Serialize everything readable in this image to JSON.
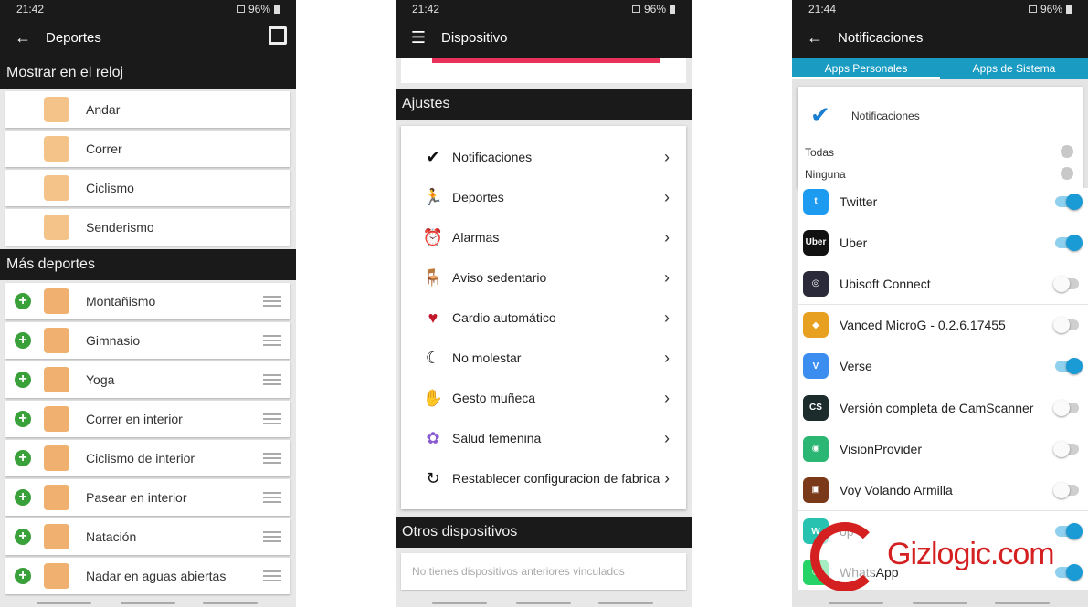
{
  "colors": {
    "dark": "#1a1a1a",
    "accent": "#1a9bc2",
    "plus_green": "#3aa03a",
    "toggle_on": "#1a9bd6"
  },
  "left": {
    "status": {
      "time": "21:42",
      "battery": "96%"
    },
    "title": "Deportes",
    "section_show": "Mostrar en el reloj",
    "shown_sports": [
      {
        "label": "Andar",
        "icon": "walking-icon"
      },
      {
        "label": "Correr",
        "icon": "running-icon"
      },
      {
        "label": "Ciclismo",
        "icon": "cycling-icon"
      },
      {
        "label": "Senderismo",
        "icon": "hiking-icon"
      }
    ],
    "section_more": "Más deportes",
    "more_sports": [
      {
        "label": "Montañismo",
        "icon": "mountain-icon"
      },
      {
        "label": "Gimnasio",
        "icon": "gym-icon"
      },
      {
        "label": "Yoga",
        "icon": "yoga-icon"
      },
      {
        "label": "Correr en interior",
        "icon": "treadmill-run-icon"
      },
      {
        "label": "Ciclismo de interior",
        "icon": "indoor-bike-icon"
      },
      {
        "label": "Pasear en interior",
        "icon": "treadmill-walk-icon"
      },
      {
        "label": "Natación",
        "icon": "swimming-icon"
      },
      {
        "label": "Nadar en aguas abiertas",
        "icon": "open-water-icon"
      }
    ]
  },
  "middle": {
    "status": {
      "time": "21:42",
      "battery": "96%"
    },
    "title": "Dispositivo",
    "section_settings": "Ajustes",
    "settings": [
      {
        "label": "Notificaciones",
        "icon": "check-icon"
      },
      {
        "label": "Deportes",
        "icon": "running-icon"
      },
      {
        "label": "Alarmas",
        "icon": "alarm-icon"
      },
      {
        "label": "Aviso sedentario",
        "icon": "chair-icon"
      },
      {
        "label": "Cardio automático",
        "icon": "heart-icon"
      },
      {
        "label": "No molestar",
        "icon": "moon-icon"
      },
      {
        "label": "Gesto muñeca",
        "icon": "hand-icon"
      },
      {
        "label": "Salud femenina",
        "icon": "lotus-icon"
      },
      {
        "label": "Restablecer configuracion de fabrica",
        "icon": "reset-icon"
      }
    ],
    "section_other": "Otros dispositivos",
    "no_devices": "No tienes dispositivos anteriores vinculados"
  },
  "right": {
    "status": {
      "time": "21:44",
      "battery": "96%"
    },
    "title": "Notificaciones",
    "tabs": [
      "Apps Personales",
      "Apps de Sistema"
    ],
    "header_label": "Notificaciones",
    "all_label": "Todas",
    "none_label": "Ninguna",
    "apps": [
      {
        "label": "Twitter",
        "on": true,
        "color": "#1d9bf0",
        "glyph": "t"
      },
      {
        "label": "Uber",
        "on": true,
        "color": "#111111",
        "glyph": "Uber"
      },
      {
        "label": "Ubisoft Connect",
        "on": false,
        "color": "#2a2a3a",
        "glyph": "◎"
      },
      {
        "label": "Vanced MicroG - 0.2.6.17455",
        "on": false,
        "color": "#e8a020",
        "glyph": "◆"
      },
      {
        "label": "Verse",
        "on": true,
        "color": "#3b8ef0",
        "glyph": "V"
      },
      {
        "label": "Versión completa de CamScanner",
        "on": false,
        "color": "#1c2b2b",
        "glyph": "CS"
      },
      {
        "label": "VisionProvider",
        "on": false,
        "color": "#2bb673",
        "glyph": "◉"
      },
      {
        "label": "Voy Volando Armilla",
        "on": false,
        "color": "#7a3a1a",
        "glyph": "▣"
      },
      {
        "label": "op",
        "on": true,
        "color": "#28c2b0",
        "glyph": "W"
      },
      {
        "label": "WhatsApp",
        "on": true,
        "color": "#25d366",
        "glyph": "✆"
      }
    ],
    "watermark": "Gizlogic.com"
  }
}
